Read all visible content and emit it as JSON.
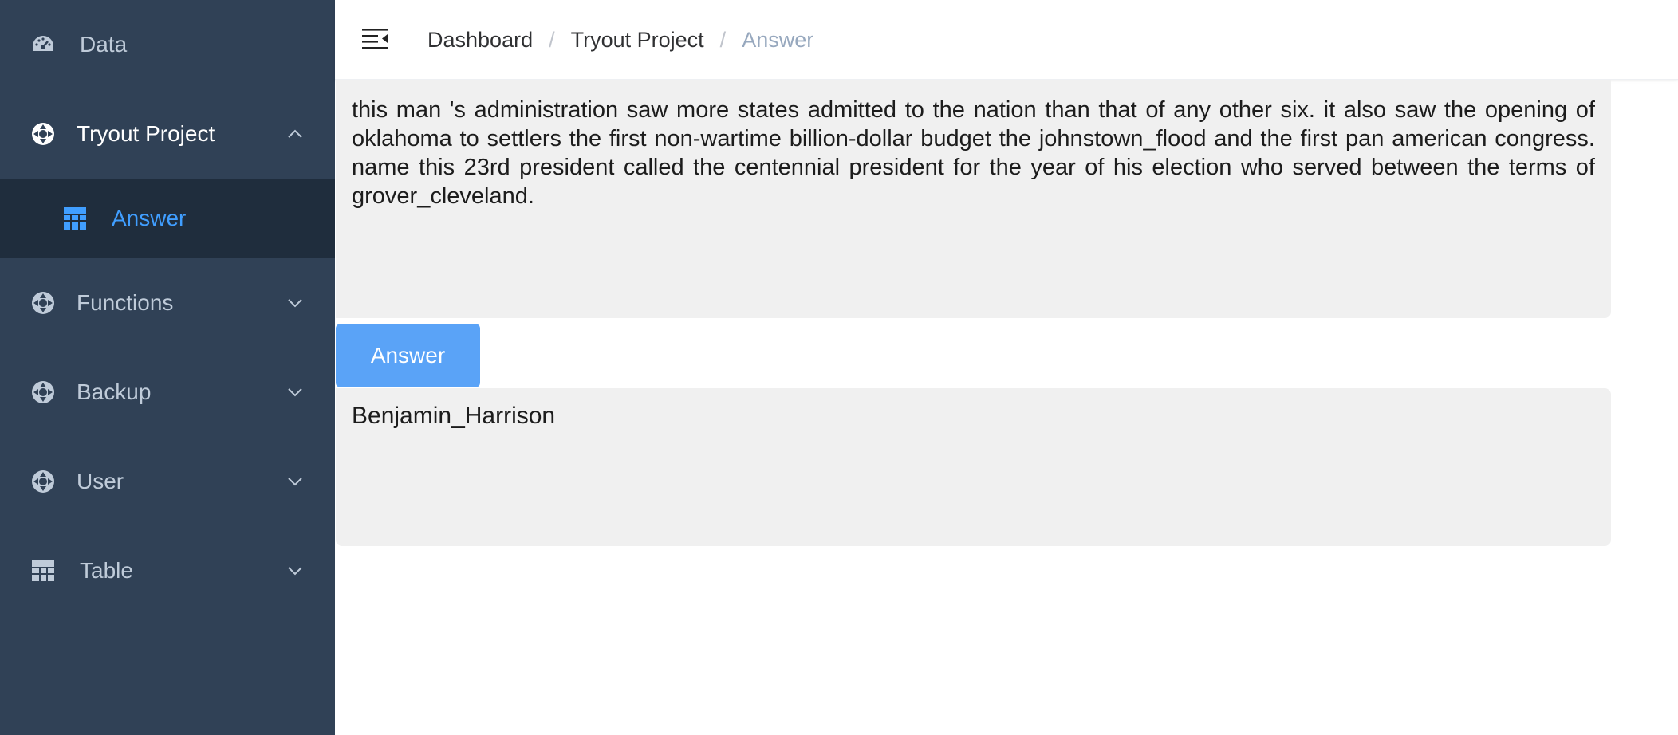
{
  "sidebar": {
    "items": [
      {
        "label": "Data",
        "icon": "dashboard-icon"
      },
      {
        "label": "Tryout Project",
        "icon": "component-icon",
        "opened": true,
        "children": [
          {
            "label": "Answer",
            "icon": "table-icon",
            "active": true
          }
        ]
      },
      {
        "label": "Functions",
        "icon": "component-icon"
      },
      {
        "label": "Backup",
        "icon": "component-icon"
      },
      {
        "label": "User",
        "icon": "component-icon"
      },
      {
        "label": "Table",
        "icon": "table-icon"
      }
    ]
  },
  "header": {
    "breadcrumb": [
      "Dashboard",
      "Tryout Project",
      "Answer"
    ]
  },
  "main": {
    "question_text": "this man 's administration saw more states admitted to the nation than that of any other six. it also saw the opening of oklahoma to settlers the first non-wartime billion-dollar budget the johnstown_flood and the first pan american congress. name this 23rd president called the centennial president for the year of his election who served between the terms of grover_cleveland.",
    "answer_button_label": "Answer",
    "answer_text": "Benjamin_Harrison"
  },
  "colors": {
    "sidebar_bg": "#304156",
    "submenu_bg": "#1f2d3d",
    "active_link": "#409eff",
    "button_bg": "#5aa3f7",
    "box_bg": "#f0f0f0"
  }
}
